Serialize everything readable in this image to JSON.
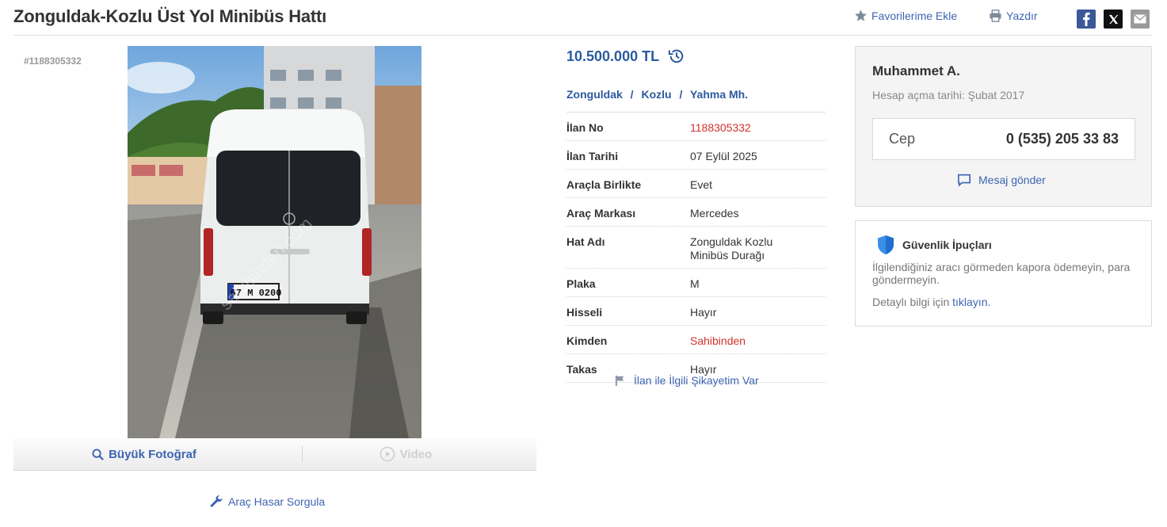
{
  "title": "Zonguldak-Kozlu Üst Yol Minibüs Hattı",
  "actions": {
    "favorite": "Favorilerime Ekle",
    "print": "Yazdır"
  },
  "social": [
    "facebook-icon",
    "x-icon",
    "mail-icon"
  ],
  "listing_id": "#1188305332",
  "photo": {
    "plate": "67 M 0200",
    "watermark": "sahibinden.com",
    "big_photo": "Büyük Fotoğraf",
    "video": "Video"
  },
  "damage_query": "Araç Hasar Sorgula",
  "price": "10.500.000 TL",
  "location": {
    "city": "Zonguldak",
    "district": "Kozlu",
    "neighborhood": "Yahma Mh.",
    "separator": "/"
  },
  "details": [
    {
      "label": "İlan No",
      "value": "1188305332",
      "highlight": true
    },
    {
      "label": "İlan Tarihi",
      "value": "07 Eylül 2025",
      "highlight": false
    },
    {
      "label": "Araçla Birlikte",
      "value": "Evet",
      "highlight": false
    },
    {
      "label": "Araç Markası",
      "value": "Mercedes",
      "highlight": false
    },
    {
      "label": "Hat Adı",
      "value": "Zonguldak Kozlu Minibüs Durağı",
      "highlight": false
    },
    {
      "label": "Plaka",
      "value": "M",
      "highlight": false
    },
    {
      "label": "Hisseli",
      "value": "Hayır",
      "highlight": false
    },
    {
      "label": "Kimden",
      "value": "Sahibinden",
      "highlight": true
    },
    {
      "label": "Takas",
      "value": "Hayır",
      "highlight": false
    }
  ],
  "complaint": "İlan ile İlgili Şikayetim Var",
  "seller": {
    "name": "Muhammet A.",
    "since": "Hesap açma tarihi: Şubat 2017",
    "phone_label": "Cep",
    "phone": "0 (535) 205 33 83",
    "message": "Mesaj gönder"
  },
  "safety": {
    "title": "Güvenlik İpuçları",
    "text": "İlgilendiğiniz aracı görmeden kapora ödemeyin, para göndermeyin.",
    "more_prefix": "Detaylı bilgi için",
    "more_link": "tıklayın."
  },
  "colors": {
    "link": "#3e64b2",
    "price": "#2c5aa0",
    "highlight": "#d0312d"
  }
}
